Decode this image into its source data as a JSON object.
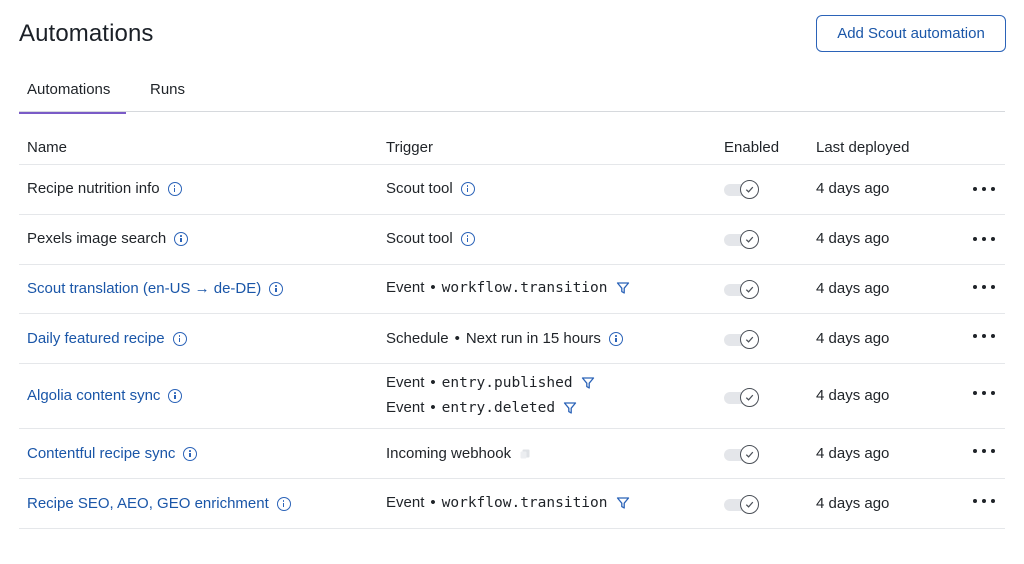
{
  "page": {
    "title": "Automations",
    "add_button": "Add Scout automation"
  },
  "tabs": [
    {
      "label": "Automations",
      "active": true
    },
    {
      "label": "Runs",
      "active": false
    }
  ],
  "columns": {
    "name": "Name",
    "trigger": "Trigger",
    "enabled": "Enabled",
    "last_deployed": "Last deployed"
  },
  "rows": [
    {
      "name": "Recipe nutrition info",
      "trigger_type": "Scout tool",
      "trigger_detail": "",
      "trigger2_type": "",
      "trigger2_detail": "",
      "enabled": true,
      "last_deployed": "4 days ago"
    },
    {
      "name": "Pexels image search",
      "trigger_type": "Scout tool",
      "trigger_detail": "",
      "trigger2_type": "",
      "trigger2_detail": "",
      "enabled": true,
      "last_deployed": "4 days ago"
    },
    {
      "name": "Scout translation (en-US → de-DE)",
      "trigger_type": "Event",
      "trigger_detail": "workflow.transition",
      "trigger2_type": "",
      "trigger2_detail": "",
      "enabled": true,
      "last_deployed": "4 days ago"
    },
    {
      "name": "Daily featured recipe",
      "trigger_type": "Schedule",
      "trigger_detail": "Next run in 15 hours",
      "trigger2_type": "",
      "trigger2_detail": "",
      "enabled": true,
      "last_deployed": "4 days ago"
    },
    {
      "name": "Algolia content sync",
      "trigger_type": "Event",
      "trigger_detail": "entry.published",
      "trigger2_type": "Event",
      "trigger2_detail": "entry.deleted",
      "enabled": true,
      "last_deployed": "4 days ago"
    },
    {
      "name": "Contentful recipe sync",
      "trigger_type": "Incoming webhook",
      "trigger_detail": "",
      "trigger2_type": "",
      "trigger2_detail": "",
      "enabled": true,
      "last_deployed": "4 days ago"
    },
    {
      "name": "Recipe SEO, AEO, GEO enrichment",
      "trigger_type": "Event",
      "trigger_detail": "workflow.transition",
      "trigger2_type": "",
      "trigger2_detail": "",
      "enabled": true,
      "last_deployed": "4 days ago"
    }
  ],
  "icons": {
    "info": "info-circle-icon",
    "filter": "filter-funnel-icon",
    "copy": "copy-icon",
    "toggle_check": "check-icon",
    "more": "more-horizontal-icon"
  },
  "colors": {
    "link": "#1a56a8",
    "tab_underline": "#7a5bc7",
    "button_border": "#2b63b8"
  }
}
